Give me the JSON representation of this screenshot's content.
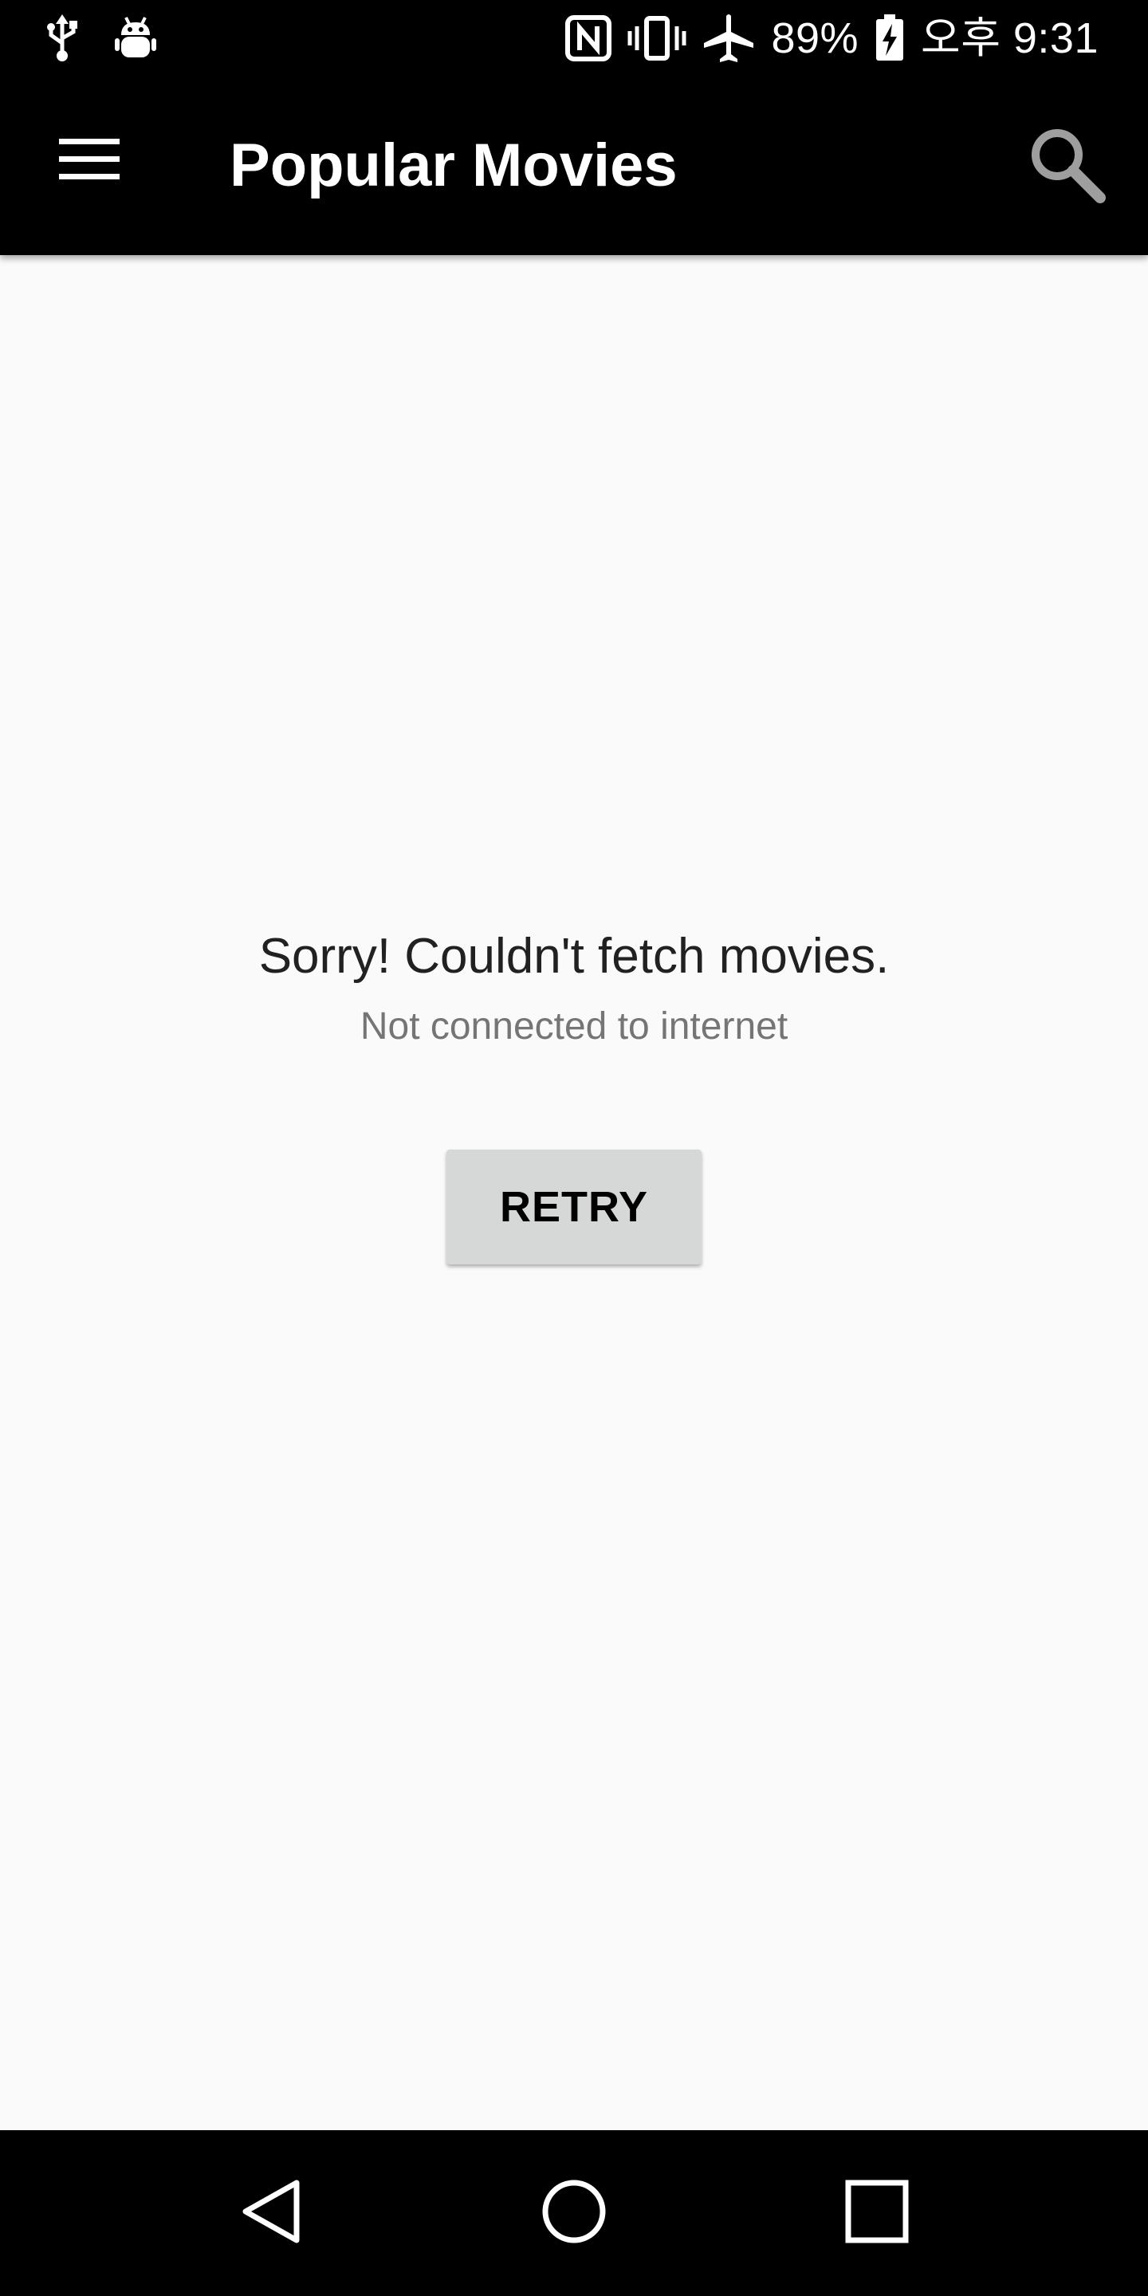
{
  "status_bar": {
    "battery": "89%",
    "time": "오후 9:31",
    "icons_left": [
      "usb-icon",
      "android-debug-icon"
    ],
    "icons_right": [
      "nfc-icon",
      "vibrate-icon",
      "airplane-mode-icon",
      "battery-charging-icon"
    ]
  },
  "app_bar": {
    "title": "Popular Movies",
    "menu_icon": "hamburger-menu-icon",
    "search_icon": "search-icon"
  },
  "main": {
    "error_title": "Sorry! Couldn't fetch movies.",
    "error_subtitle": "Not connected to internet",
    "retry_label": "RETRY"
  },
  "nav_bar": {
    "icons": [
      "back-icon",
      "home-icon",
      "recent-apps-icon"
    ]
  },
  "colors": {
    "bars": "#000000",
    "background": "#fafafa",
    "button": "#d6d7d7",
    "title_text": "#212121",
    "subtitle_text": "#757575"
  }
}
